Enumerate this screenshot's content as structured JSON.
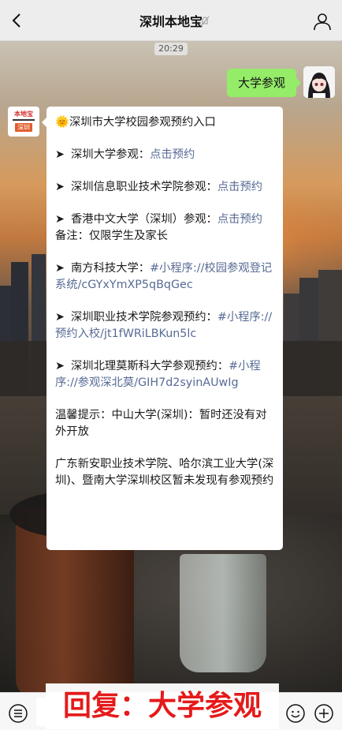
{
  "header": {
    "title": "深圳本地宝"
  },
  "chat": {
    "timestamp": "20:29",
    "sent_message": "大学参观",
    "bot_avatar": {
      "logo_text": "本地宝",
      "logo_sub": "深圳"
    },
    "received": {
      "heading": "深圳市大学校园参观预约入口",
      "items": [
        {
          "prefix": "深圳大学参观：",
          "link": "点击预约"
        },
        {
          "prefix": "深圳信息职业技术学院参观：",
          "link": "点击预约"
        },
        {
          "prefix": "香港中文大学（深圳）参观：",
          "link": "点击预约",
          "note": "备注：仅限学生及家长"
        },
        {
          "prefix": "南方科技大学：",
          "link": "#小程序://校园参观登记系统/cGYxYmXP5qBqGec"
        },
        {
          "prefix": "深圳职业技术学院参观预约：",
          "link": "#小程序://预约入校/jt1fWRiLBKun5lc"
        },
        {
          "prefix": "深圳北理莫斯科大学参观预约：",
          "link": "#小程序://参观深北莫/GIH7d2syinAUwIg"
        }
      ],
      "tip": "温馨提示：中山大学(深圳)：暂时还没有对外开放",
      "footer": "广东新安职业技术学院、哈尔滨工业大学(深圳)、暨南大学深圳校区暂未发现有参观预约"
    }
  },
  "overlay_text": "回复：大学参观",
  "colors": {
    "sent_bubble": "#95ec69",
    "link": "#576b95",
    "overlay": "#e51a1a"
  }
}
